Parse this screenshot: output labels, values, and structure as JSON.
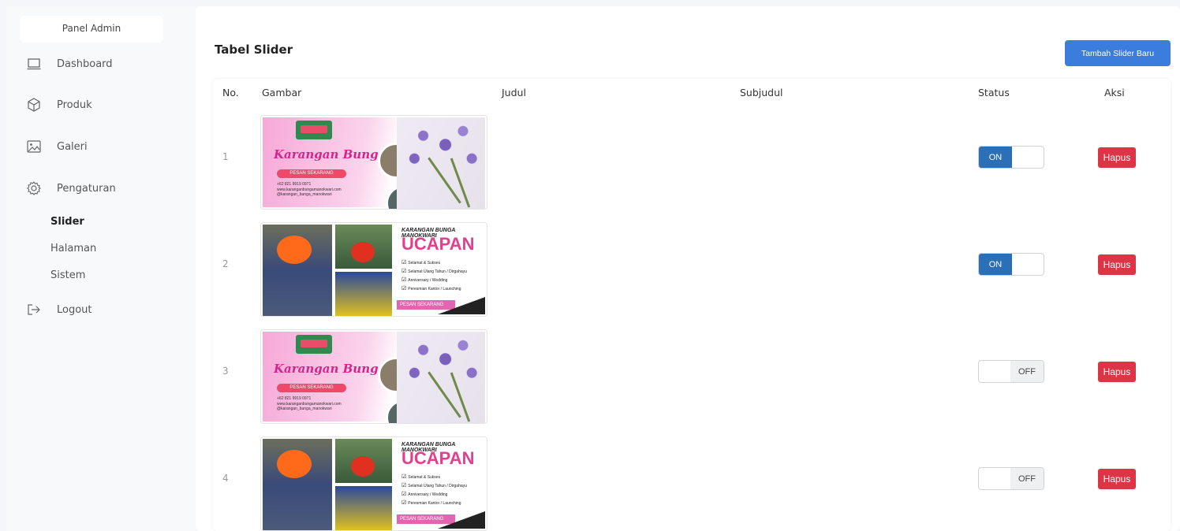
{
  "sidebar": {
    "brand": "Panel Admin",
    "items": [
      {
        "label": "Dashboard",
        "icon": "laptop-icon"
      },
      {
        "label": "Produk",
        "icon": "box-icon"
      },
      {
        "label": "Galeri",
        "icon": "image-icon"
      },
      {
        "label": "Pengaturan",
        "icon": "gear-icon"
      }
    ],
    "sub_items": [
      "Slider",
      "Halaman",
      "Sistem"
    ],
    "logout": "Logout"
  },
  "main": {
    "title": "Tabel Slider",
    "add_button": "Tambah Slider Baru",
    "columns": [
      "No.",
      "Gambar",
      "Judul",
      "Subjudul",
      "Status",
      "Aksi"
    ],
    "rows": [
      {
        "no": "1",
        "status": "ON",
        "action": "Hapus",
        "banner": "A"
      },
      {
        "no": "2",
        "status": "ON",
        "action": "Hapus",
        "banner": "B"
      },
      {
        "no": "3",
        "status": "OFF",
        "action": "Hapus",
        "banner": "A"
      },
      {
        "no": "4",
        "status": "OFF",
        "action": "Hapus",
        "banner": "B"
      }
    ]
  },
  "banner_a": {
    "script": "Karangan Bunga",
    "cta": "PESAN SEKARANG",
    "phone": "+62 821 9919 0971",
    "web": "www.karanganbungamanokwari.com",
    "ig": "@karangan_bunga_manokwari"
  },
  "banner_b": {
    "title": "KARANGAN BUNGA MANOKWARI",
    "big": "UCAPAN",
    "checks": [
      "Selamat & Sukses",
      "Selamat Ulang Tahun / Dirgahayu",
      "Anniversary / Wedding",
      "Peresmian Kantor / Launching"
    ],
    "cta": "PESAN SEKARANG"
  },
  "colors": {
    "primary": "#3b7ddd",
    "toggle_on": "#2c6fb7",
    "danger": "#dc3545"
  }
}
